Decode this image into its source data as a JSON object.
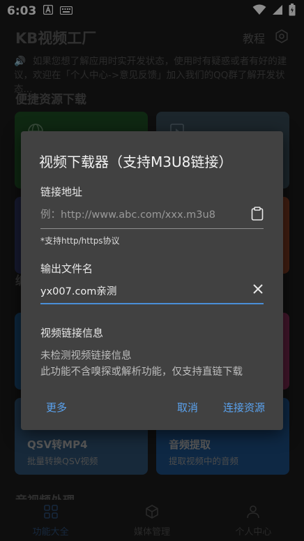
{
  "status_bar": {
    "time": "6:03"
  },
  "app": {
    "title": "KB视频工厂",
    "tutorial_label": "教程"
  },
  "notice": {
    "text": "如果您想了解应用时实开发状态，使用时有疑惑或者有好的建议，欢迎在「个人中心->意见反馈」加入我们的QQ群了解开发状态..."
  },
  "sections": {
    "quick_download": "便捷资源下载",
    "section2_partial": "编",
    "audio_video": "音视频处理"
  },
  "cards": [
    {
      "title": "QSV转MP4",
      "subtitle": "批量转换QSV视频",
      "color": "#2b4c6a"
    },
    {
      "title": "音频提取",
      "subtitle": "提取视频中的音频",
      "color": "#1a4a7c"
    }
  ],
  "bottom_nav": [
    {
      "label": "功能大全",
      "icon": "grid-icon",
      "active": true
    },
    {
      "label": "媒体管理",
      "icon": "cube-icon",
      "active": false
    },
    {
      "label": "个人中心",
      "icon": "person-icon",
      "active": false
    }
  ],
  "dialog": {
    "title": "视频下载器（支持M3U8链接）",
    "url_label": "链接地址",
    "url_placeholder": "例：http://www.abc.com/xxx.m3u8",
    "url_value": "",
    "url_hint": "*支持http/https协议",
    "filename_label": "输出文件名",
    "filename_value": "yx007.com亲测",
    "info_label": "视频链接信息",
    "info_status": "未检测视频链接信息",
    "info_note": "此功能不含嗅探或解析功能，仅支持直链下载",
    "btn_more": "更多",
    "btn_cancel": "取消",
    "btn_connect": "连接资源"
  },
  "colors": {
    "accent": "#5aa2ee",
    "underline_focus": "#4a8fd8",
    "dialog_bg": "#414141"
  }
}
